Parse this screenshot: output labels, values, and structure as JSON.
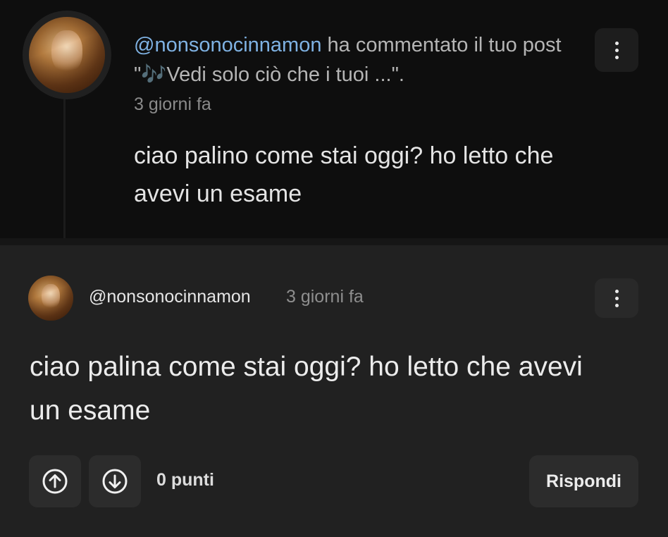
{
  "notification": {
    "username": "@nonsonocinnamon",
    "action_text": " ha commentato il tuo post \"🎶Vedi solo ciò che i tuoi ...\".",
    "time": "3 giorni fa",
    "body": "ciao palino come stai oggi? ho letto che avevi un esame",
    "icons": {
      "avatar": "user-avatar",
      "menu": "more-vertical-icon"
    }
  },
  "comment": {
    "username": "@nonsonocinnamon",
    "time": "3 giorni fa",
    "body": "ciao palina come stai oggi? ho letto che avevi un esame",
    "points": "0 punti",
    "reply_label": "Rispondi",
    "icons": {
      "avatar": "user-avatar",
      "menu": "more-vertical-icon",
      "upvote": "arrow-up-circle-icon",
      "downvote": "arrow-down-circle-icon"
    }
  },
  "colors": {
    "username_link": "#7fb2e3",
    "notification_bg": "#0e0e0e",
    "comment_bg": "#212121"
  }
}
